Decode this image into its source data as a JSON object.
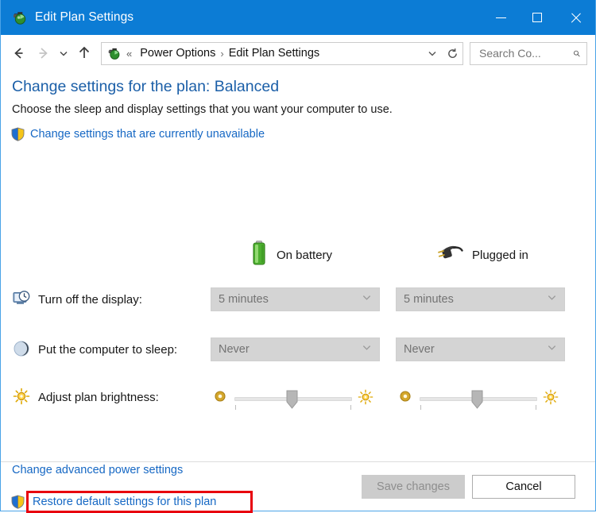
{
  "window": {
    "title": "Edit Plan Settings",
    "icon": "power-plan-icon",
    "accent_color": "#0c7cd5",
    "controls": {
      "minimize": "Minimize",
      "maximize": "Maximize",
      "close": "Close"
    }
  },
  "navbar": {
    "back": "Back",
    "forward": "Forward",
    "recent": "Recent locations",
    "up": "Up",
    "breadcrumb": {
      "icon": "power-plan-icon",
      "overflow": "«",
      "items": [
        "Power Options",
        "Edit Plan Settings"
      ],
      "separator": "›"
    },
    "refresh": "Refresh",
    "search": {
      "placeholder": "Search Co...",
      "value": ""
    }
  },
  "page": {
    "title": "Change settings for the plan: Balanced",
    "subtitle": "Choose the sleep and display settings that you want your computer to use.",
    "unavailable_link": "Change settings that are currently unavailable"
  },
  "columns": [
    {
      "label": "On battery",
      "icon": "battery-icon"
    },
    {
      "label": "Plugged in",
      "icon": "power-plug-icon"
    }
  ],
  "settings": [
    {
      "label": "Turn off the display:",
      "icon": "display-clock-icon",
      "type": "dropdown",
      "on_battery": "5 minutes",
      "plugged_in": "5 minutes",
      "disabled": true
    },
    {
      "label": "Put the computer to sleep:",
      "icon": "sleep-moon-icon",
      "type": "dropdown",
      "on_battery": "Never",
      "plugged_in": "Never",
      "disabled": true
    },
    {
      "label": "Adjust plan brightness:",
      "icon": "brightness-sun-icon",
      "type": "slider",
      "on_battery": 50,
      "plugged_in": 50,
      "min_icon": "dim-sun-icon",
      "max_icon": "bright-sun-icon"
    }
  ],
  "links": {
    "advanced": "Change advanced power settings",
    "restore": "Restore default settings for this plan",
    "restore_highlight_color": "#e8000d",
    "link_color": "#1668c4"
  },
  "footer": {
    "save_label": "Save changes",
    "save_disabled": true,
    "cancel_label": "Cancel"
  }
}
